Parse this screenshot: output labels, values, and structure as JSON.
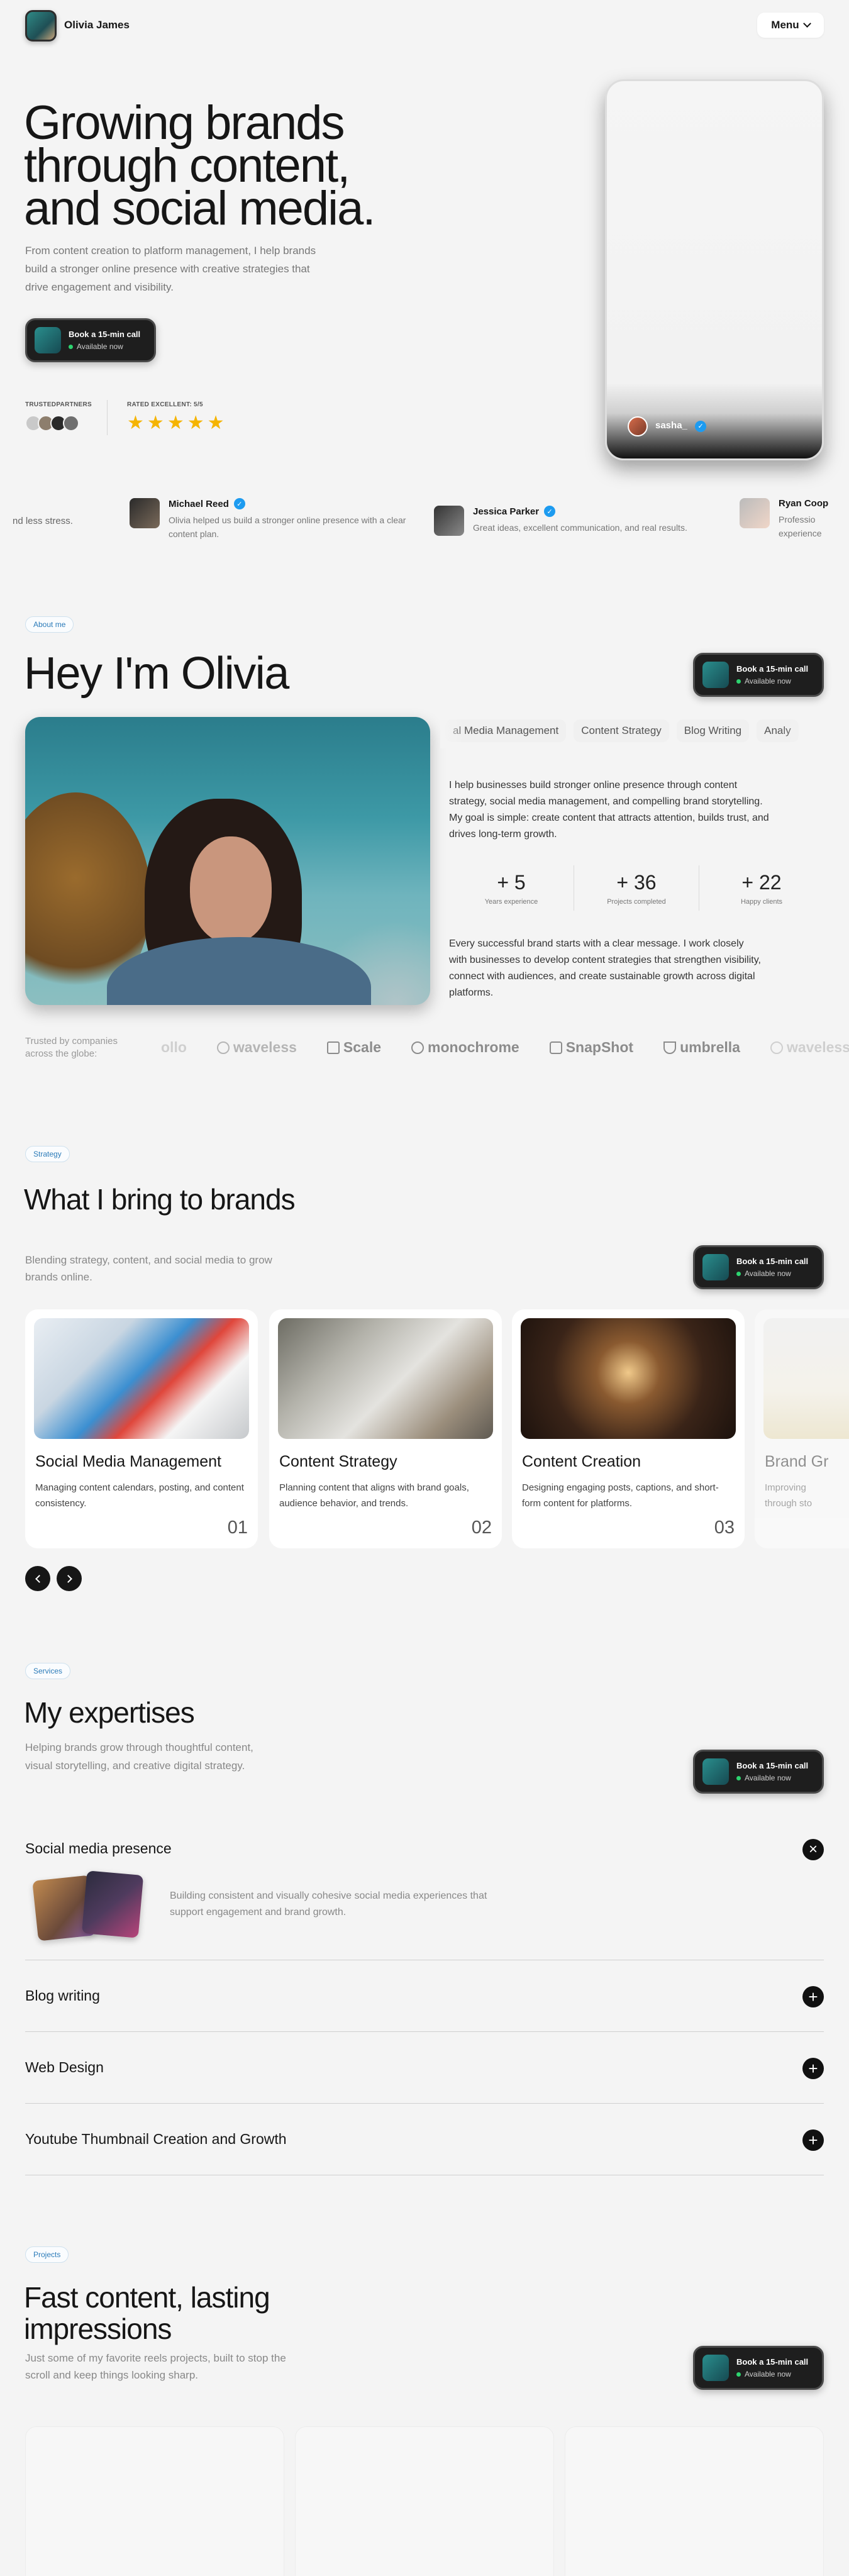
{
  "header": {
    "name": "Olivia James",
    "menu_label": "Menu"
  },
  "hero": {
    "title_lines": [
      "Growing brands",
      "through content,",
      "and social media."
    ],
    "description": "From content creation to platform management, I help brands build a stronger online presence with creative strategies that drive engagement and visibility.",
    "trusted_partners_label": "TRUSTEDPARTNERS",
    "rated_label": "RATED EXCELLENT: 5/5",
    "stars": 5,
    "phone_username": "sasha_"
  },
  "cta": {
    "label": "Book a 15-min call",
    "status": "Available now"
  },
  "testimonials": {
    "fragment": "nd less stress.",
    "items": [
      {
        "name": "Michael Reed",
        "text": "Olivia helped us build a stronger online presence with a clear content plan."
      },
      {
        "name": "Jessica Parker",
        "text": "Great ideas, excellent communication, and real results."
      },
      {
        "name": "Ryan Coop",
        "text": "Professio experience"
      }
    ]
  },
  "about": {
    "badge": "About me",
    "title": "Hey I'm Olivia",
    "skills": [
      "al Media Management",
      "Content Strategy",
      "Blog Writing",
      "Analy"
    ],
    "para1": "I help businesses build stronger online presence through content strategy, social media management, and compelling brand storytelling. My goal is simple: create content that attracts attention, builds trust, and drives long-term growth.",
    "stats": [
      {
        "num": "+ 5",
        "label": "Years experience"
      },
      {
        "num": "+ 36",
        "label": "Projects completed"
      },
      {
        "num": "+ 22",
        "label": "Happy clients"
      }
    ],
    "para2": "Every successful brand starts with a clear message. I work closely with businesses to develop content strategies that strengthen visibility, connect with audiences, and create sustainable growth across digital platforms."
  },
  "trusted": {
    "label": "Trusted by companies across the globe:",
    "logos": [
      "ollo",
      "waveless",
      "Scale",
      "monochrome",
      "SnapShot",
      "umbrella",
      "waveless"
    ]
  },
  "strategy": {
    "badge": "Strategy",
    "title": "What I bring to brands",
    "description": "Blending strategy, content, and social media to grow brands online.",
    "cards": [
      {
        "title": "Social Media Management",
        "desc": "Managing content calendars, posting, and content consistency.",
        "num": "01"
      },
      {
        "title": "Content Strategy",
        "desc": "Planning content that aligns with brand goals, audience behavior, and trends.",
        "num": "02"
      },
      {
        "title": "Content Creation",
        "desc": "Designing engaging posts, captions, and short-form content for platforms.",
        "num": "03"
      },
      {
        "title": "Brand Gr",
        "desc": "Improving through sto",
        "num": ""
      }
    ]
  },
  "expertises": {
    "badge": "Services",
    "title": "My expertises",
    "description": "Helping brands grow through thoughtful content, visual storytelling, and creative digital strategy.",
    "items": [
      {
        "title": "Social media presence",
        "desc": "Building consistent and visually cohesive social media experiences that support engagement and brand growth.",
        "icon": "×"
      },
      {
        "title": "Blog writing",
        "icon": "+"
      },
      {
        "title": "Web Design",
        "icon": "+"
      },
      {
        "title": "Youtube Thumbnail Creation and Growth",
        "icon": "+"
      }
    ]
  },
  "projects": {
    "badge": "Projects",
    "title": "Fast content, lasting impressions",
    "description": "Just some of my favorite reels projects, built to stop the scroll and keep things looking sharp."
  },
  "colors": {
    "accent_blue": "#1d9bf0",
    "star": "#f5b400",
    "available": "#2dd36f",
    "dark": "#161616"
  }
}
